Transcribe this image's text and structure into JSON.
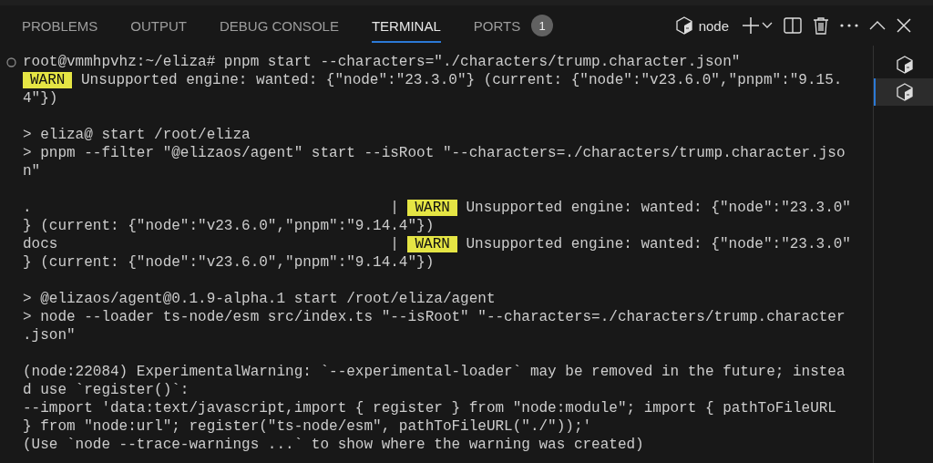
{
  "tabs": [
    {
      "label": "PROBLEMS",
      "selected": false
    },
    {
      "label": "OUTPUT",
      "selected": false
    },
    {
      "label": "DEBUG CONSOLE",
      "selected": false
    },
    {
      "label": "TERMINAL",
      "selected": true
    },
    {
      "label": "PORTS",
      "selected": false,
      "badge": "1"
    }
  ],
  "toolbar": {
    "terminal_name": "node"
  },
  "terminal_lines": [
    {
      "kind": "prompt",
      "segments": [
        {
          "kind": "text",
          "text": "root@vmmhpvhz:~/eliza# pnpm start --characters=\"./characters/trump.character.json\""
        }
      ]
    },
    {
      "kind": "output",
      "segments": [
        {
          "kind": "warn",
          "text": "WARN"
        },
        {
          "kind": "text",
          "text": " Unsupported engine: wanted: {\"node\":\"23.3.0\"} (current: {\"node\":\"v23.6.0\",\"pnpm\":\"9.15."
        }
      ]
    },
    {
      "kind": "output",
      "segments": [
        {
          "kind": "text",
          "text": "4\"})"
        }
      ]
    },
    {
      "kind": "blank"
    },
    {
      "kind": "output",
      "segments": [
        {
          "kind": "text",
          "text": "> eliza@ start /root/eliza"
        }
      ]
    },
    {
      "kind": "output",
      "segments": [
        {
          "kind": "text",
          "text": "> pnpm --filter \"@elizaos/agent\" start --isRoot \"--characters=./characters/trump.character.jso"
        }
      ]
    },
    {
      "kind": "output",
      "segments": [
        {
          "kind": "text",
          "text": "n\""
        }
      ]
    },
    {
      "kind": "blank"
    },
    {
      "kind": "output",
      "segments": [
        {
          "kind": "text",
          "text": ".                                         | "
        },
        {
          "kind": "warn",
          "text": "WARN"
        },
        {
          "kind": "text",
          "text": " Unsupported engine: wanted: {\"node\":\"23.3.0\""
        }
      ]
    },
    {
      "kind": "output",
      "segments": [
        {
          "kind": "text",
          "text": "} (current: {\"node\":\"v23.6.0\",\"pnpm\":\"9.14.4\"})"
        }
      ]
    },
    {
      "kind": "output",
      "segments": [
        {
          "kind": "text",
          "text": "docs                                      | "
        },
        {
          "kind": "warn",
          "text": "WARN"
        },
        {
          "kind": "text",
          "text": " Unsupported engine: wanted: {\"node\":\"23.3.0\""
        }
      ]
    },
    {
      "kind": "output",
      "segments": [
        {
          "kind": "text",
          "text": "} (current: {\"node\":\"v23.6.0\",\"pnpm\":\"9.14.4\"})"
        }
      ]
    },
    {
      "kind": "blank"
    },
    {
      "kind": "output",
      "segments": [
        {
          "kind": "text",
          "text": "> @elizaos/agent@0.1.9-alpha.1 start /root/eliza/agent"
        }
      ]
    },
    {
      "kind": "output",
      "segments": [
        {
          "kind": "text",
          "text": "> node --loader ts-node/esm src/index.ts \"--isRoot\" \"--characters=./characters/trump.character"
        }
      ]
    },
    {
      "kind": "output",
      "segments": [
        {
          "kind": "text",
          "text": ".json\""
        }
      ]
    },
    {
      "kind": "blank"
    },
    {
      "kind": "output",
      "segments": [
        {
          "kind": "text",
          "text": "(node:22084) ExperimentalWarning: `--experimental-loader` may be removed in the future; instea"
        }
      ]
    },
    {
      "kind": "output",
      "segments": [
        {
          "kind": "text",
          "text": "d use `register()`:"
        }
      ]
    },
    {
      "kind": "output",
      "segments": [
        {
          "kind": "text",
          "text": "--import 'data:text/javascript,import { register } from \"node:module\"; import { pathToFileURL"
        }
      ]
    },
    {
      "kind": "output",
      "segments": [
        {
          "kind": "text",
          "text": "} from \"node:url\"; register(\"ts-node/esm\", pathToFileURL(\"./\"));'"
        }
      ]
    },
    {
      "kind": "output",
      "segments": [
        {
          "kind": "text",
          "text": "(Use `node --trace-warnings ...` to show where the warning was created)"
        }
      ]
    }
  ],
  "terminal_list": [
    {
      "selected": false
    },
    {
      "selected": true
    }
  ]
}
